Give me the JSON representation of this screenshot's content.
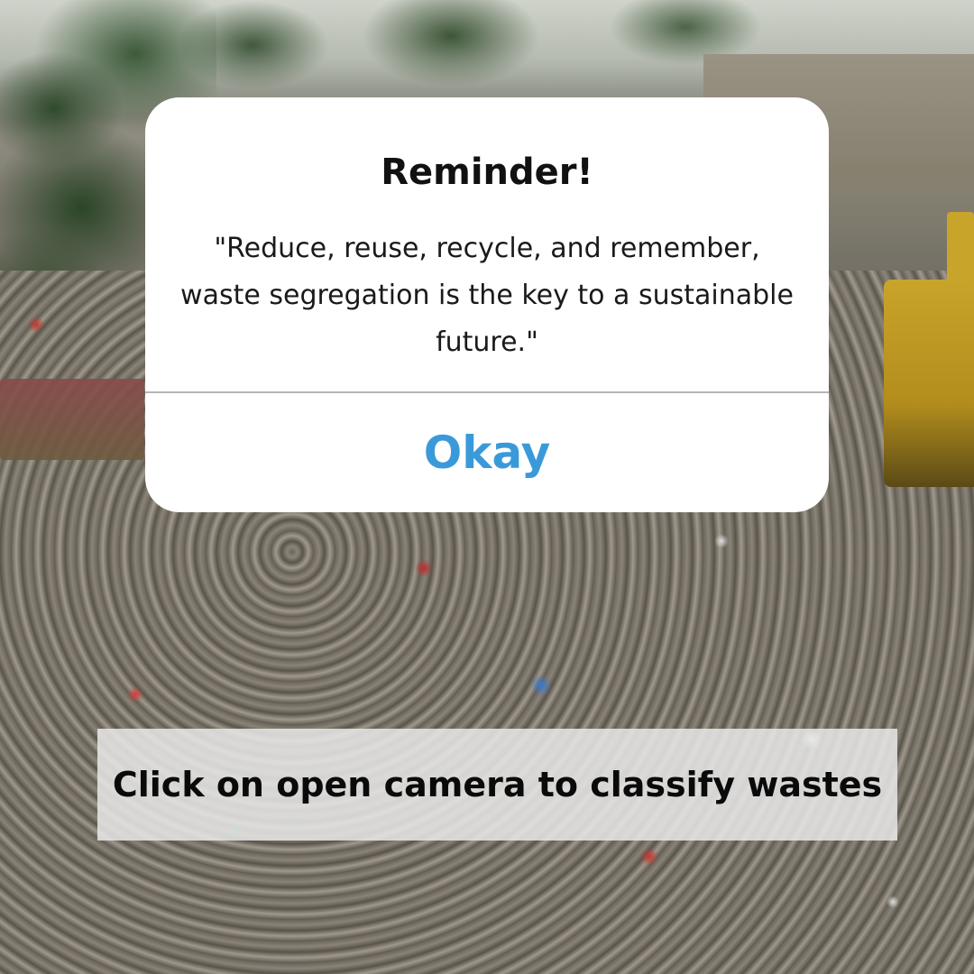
{
  "dialog": {
    "title": "Reminder!",
    "message": "\"Reduce, reuse, recycle, and remember, waste segregation is the key to a sustainable future.\"",
    "okay_label": "Okay"
  },
  "hint": {
    "text": "Click on open camera to classify wastes"
  },
  "colors": {
    "okay_text": "#3a9ad9",
    "dialog_background": "#ffffff",
    "hint_background": "#e8e8e8"
  }
}
